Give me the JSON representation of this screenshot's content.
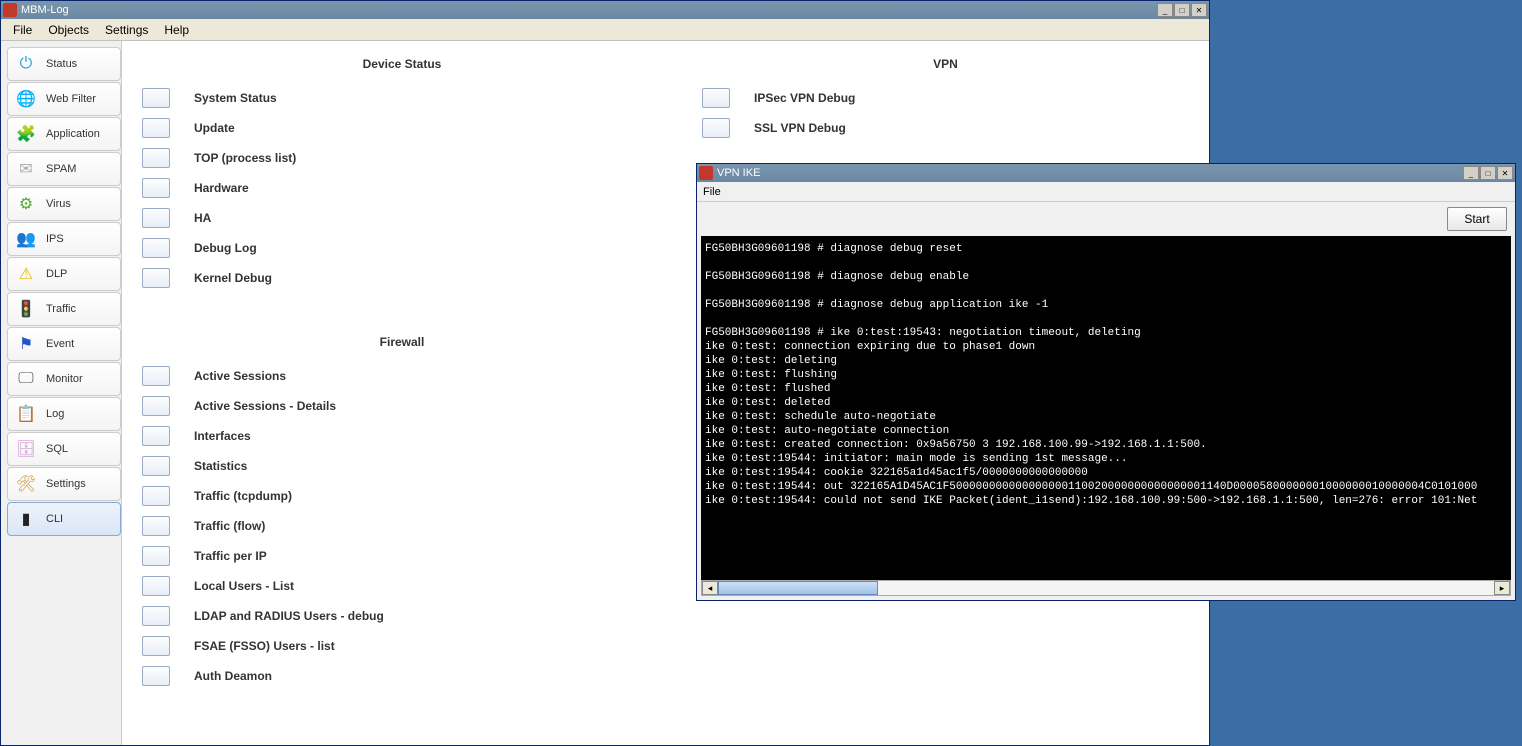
{
  "main_window": {
    "title": "MBM-Log",
    "menubar": [
      "File",
      "Objects",
      "Settings",
      "Help"
    ]
  },
  "sidebar": {
    "items": [
      {
        "label": "Status",
        "icon": "⏻",
        "color": "#2aa0d8"
      },
      {
        "label": "Web Filter",
        "icon": "🌐",
        "color": "#3a7"
      },
      {
        "label": "Application",
        "icon": "🧩",
        "color": "#48a"
      },
      {
        "label": "SPAM",
        "icon": "✉",
        "color": "#aaa"
      },
      {
        "label": "Virus",
        "icon": "⚙",
        "color": "#5a3"
      },
      {
        "label": "IPS",
        "icon": "👥",
        "color": "#333"
      },
      {
        "label": "DLP",
        "icon": "⚠",
        "color": "#e6b800"
      },
      {
        "label": "Traffic",
        "icon": "🚦",
        "color": "#c33"
      },
      {
        "label": "Event",
        "icon": "⚑",
        "color": "#25c"
      },
      {
        "label": "Monitor",
        "icon": "🖵",
        "color": "#555"
      },
      {
        "label": "Log",
        "icon": "📋",
        "color": "#36c"
      },
      {
        "label": "SQL",
        "icon": "🗄",
        "color": "#c9c"
      },
      {
        "label": "Settings",
        "icon": "🛠",
        "color": "#cc9933"
      },
      {
        "label": "CLI",
        "icon": "▮",
        "color": "#222",
        "selected": true
      }
    ]
  },
  "sections": {
    "device_status": {
      "title": "Device Status",
      "items": [
        "System Status",
        "Update",
        "TOP (process list)",
        "Hardware",
        "HA",
        "Debug Log",
        "Kernel Debug"
      ]
    },
    "firewall": {
      "title": "Firewall",
      "items": [
        "Active Sessions",
        "Active Sessions - Details",
        "Interfaces",
        "Statistics",
        "Traffic (tcpdump)",
        "Traffic (flow)",
        "Traffic per IP",
        "Local Users - List",
        "LDAP and RADIUS Users - debug",
        "FSAE (FSSO) Users - list",
        "Auth Deamon"
      ]
    },
    "vpn": {
      "title": "VPN",
      "items": [
        "IPSec VPN Debug",
        "SSL VPN Debug"
      ]
    }
  },
  "popup": {
    "title": "VPN IKE",
    "menubar": [
      "File"
    ],
    "start_label": "Start",
    "terminal": "FG50BH3G09601198 # diagnose debug reset\n\nFG50BH3G09601198 # diagnose debug enable\n\nFG50BH3G09601198 # diagnose debug application ike -1\n\nFG50BH3G09601198 # ike 0:test:19543: negotiation timeout, deleting\nike 0:test: connection expiring due to phase1 down\nike 0:test: deleting\nike 0:test: flushing\nike 0:test: flushed\nike 0:test: deleted\nike 0:test: schedule auto-negotiate\nike 0:test: auto-negotiate connection\nike 0:test: created connection: 0x9a56750 3 192.168.100.99->192.168.1.1:500.\nike 0:test:19544: initiator: main mode is sending 1st message...\nike 0:test:19544: cookie 322165a1d45ac1f5/0000000000000000\nike 0:test:19544: out 322165A1D45AC1F500000000000000000110020000000000000001140D00005800000001000000010000004C0101000\nike 0:test:19544: could not send IKE Packet(ident_i1send):192.168.100.99:500->192.168.1.1:500, len=276: error 101:Net"
  }
}
